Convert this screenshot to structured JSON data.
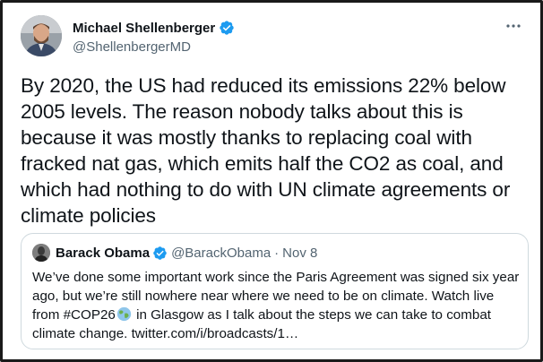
{
  "tweet": {
    "author": {
      "display_name": "Michael Shellenberger",
      "handle": "@ShellenbergerMD",
      "verified": true
    },
    "more_icon": "more-horizontal-icon",
    "text": "By 2020, the US had reduced its emissions 22% below 2005 levels. The reason nobody talks about this is because it was mostly thanks to replacing coal with fracked nat gas, which emits half the CO2 as coal, and which had nothing to do with UN climate agreements or climate policies"
  },
  "quoted": {
    "author": {
      "display_name": "Barack Obama",
      "handle": "@BarackObama",
      "verified": true
    },
    "separator": "·",
    "date": "Nov 8",
    "text_before": "We’ve done some important work since the Paris Agreement was signed six year ago, but we’re still nowhere near where we need to be on climate. Watch live from #COP26",
    "text_emoji": "globe-emoji",
    "text_after": " in Glasgow as I talk about the steps we can take to combat climate change. twitter.com/i/broadcasts/1…"
  },
  "colors": {
    "text_primary": "#0f1419",
    "text_secondary": "#536471",
    "verified_blue": "#1d9bf0",
    "border": "#cfd9de"
  }
}
